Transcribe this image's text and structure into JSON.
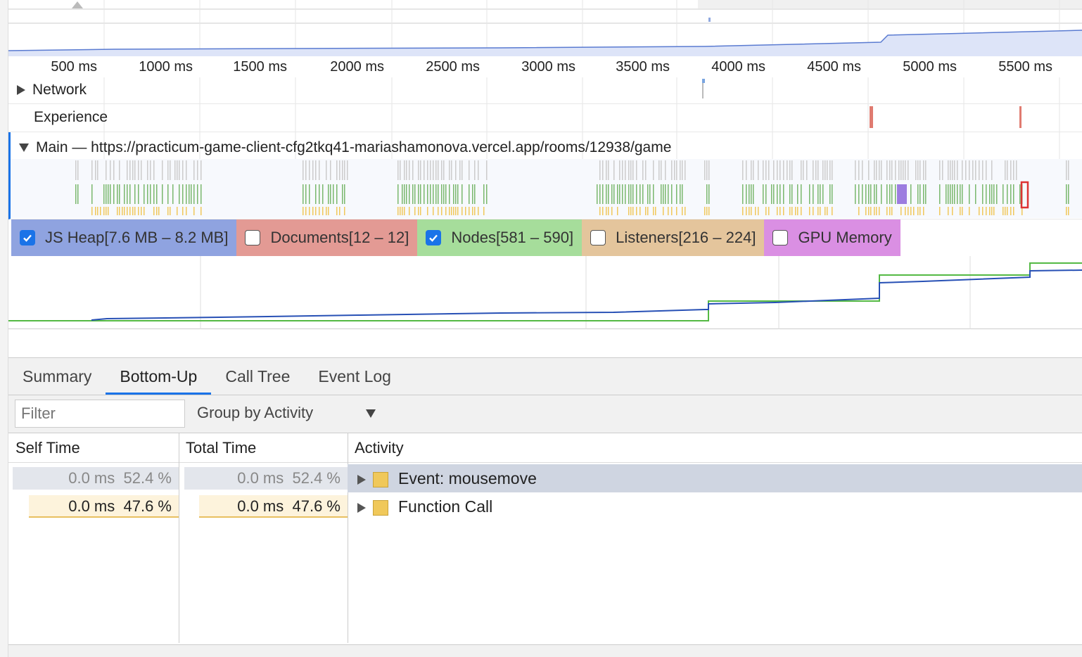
{
  "ruler": {
    "ticks": [
      "500 ms",
      "1000 ms",
      "1500 ms",
      "2000 ms",
      "2500 ms",
      "3000 ms",
      "3500 ms",
      "4000 ms",
      "4500 ms",
      "5000 ms",
      "5500 ms"
    ]
  },
  "tracks": {
    "network_label": "Network",
    "experience_label": "Experience",
    "main_label": "Main — https://practicum-game-client-cfg2tkq41-mariashamonova.vercel.app/rooms/12938/game"
  },
  "counters": [
    {
      "label": "JS Heap[7.6 MB – 8.2 MB]",
      "checked": true,
      "color": "#8fa3e0"
    },
    {
      "label": "Documents[12 – 12]",
      "checked": false,
      "color": "#e39a94"
    },
    {
      "label": "Nodes[581 – 590]",
      "checked": true,
      "color": "#a6dd9b"
    },
    {
      "label": "Listeners[216 – 224]",
      "checked": false,
      "color": "#e4c59c"
    },
    {
      "label": "GPU Memory",
      "checked": false,
      "color": "#da8fe3"
    }
  ],
  "tabs": [
    "Summary",
    "Bottom-Up",
    "Call Tree",
    "Event Log"
  ],
  "active_tab": "Bottom-Up",
  "toolbar": {
    "filter_placeholder": "Filter",
    "group_by": "Group by Activity"
  },
  "table": {
    "headers": {
      "self": "Self Time",
      "total": "Total Time",
      "activity": "Activity"
    },
    "rows": [
      {
        "self_time": "0.0 ms",
        "self_pct": "52.4 %",
        "total_time": "0.0 ms",
        "total_pct": "52.4 %",
        "activity": "Event: mousemove",
        "selected": true
      },
      {
        "self_time": "0.0 ms",
        "self_pct": "47.6 %",
        "total_time": "0.0 ms",
        "total_pct": "47.6 %",
        "activity": "Function Call",
        "selected": false
      }
    ]
  },
  "colors": {
    "scripting": "#f0c85a",
    "rendering": "#9c7ce0",
    "painting": "#7ab86d",
    "heap_line": "#2750b5",
    "nodes_line": "#54b944",
    "experience_mark": "#e07b70",
    "accent": "#1a73e8"
  }
}
